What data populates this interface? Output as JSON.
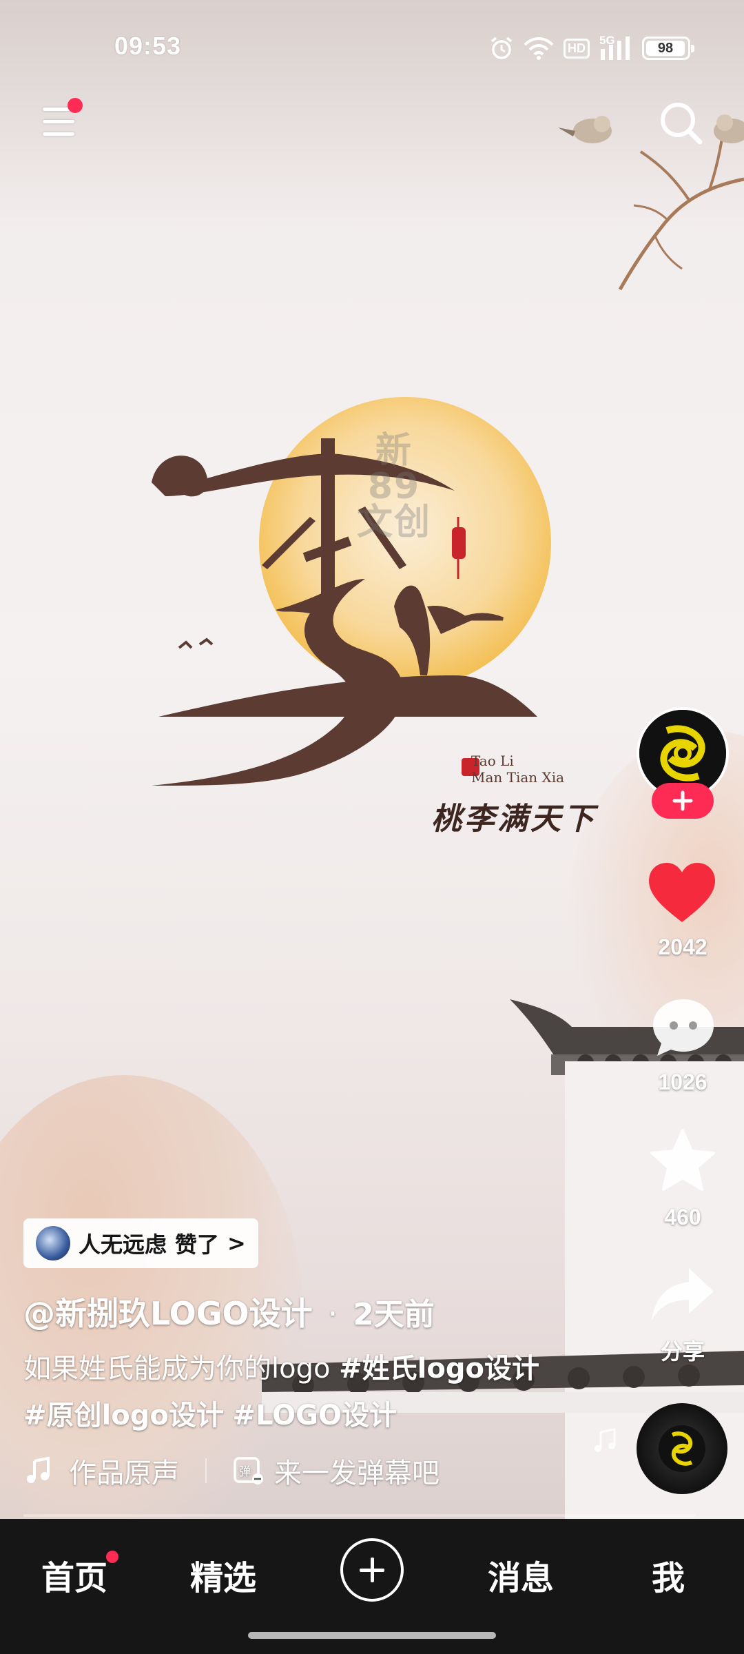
{
  "status_bar": {
    "time": "09:53",
    "hd": "HD",
    "network": "5G",
    "battery": "98"
  },
  "top_bar": {
    "menu_icon": "menu-icon",
    "search_icon": "search-icon"
  },
  "video": {
    "logo_lines": [
      "Tao Li",
      "Man Tian Xia"
    ],
    "logo_calligraphy": "桃李满天下",
    "watermark": "新89文创"
  },
  "side_actions": {
    "like_count": "2042",
    "comment_count": "1026",
    "favorite_count": "460",
    "share_label": "分享"
  },
  "liked_by": {
    "name": "人无远虑",
    "action": "赞了",
    "chevron": ">"
  },
  "post": {
    "author": "@新捌玖LOGO设计",
    "separator": "·",
    "time_ago": "2天前",
    "caption_text": "如果姓氏能成为你的logo ",
    "hashtags": [
      "#姓氏logo设计",
      "#原创logo设计",
      "#LOGO设计"
    ]
  },
  "music_row": {
    "music_label": "作品原声",
    "danmaku_placeholder": "来一发弹幕吧"
  },
  "tab_bar": {
    "tabs": [
      "首页",
      "精选",
      "消息",
      "我"
    ]
  },
  "colors": {
    "accent": "#fe2c55",
    "tabbar": "#161616"
  }
}
